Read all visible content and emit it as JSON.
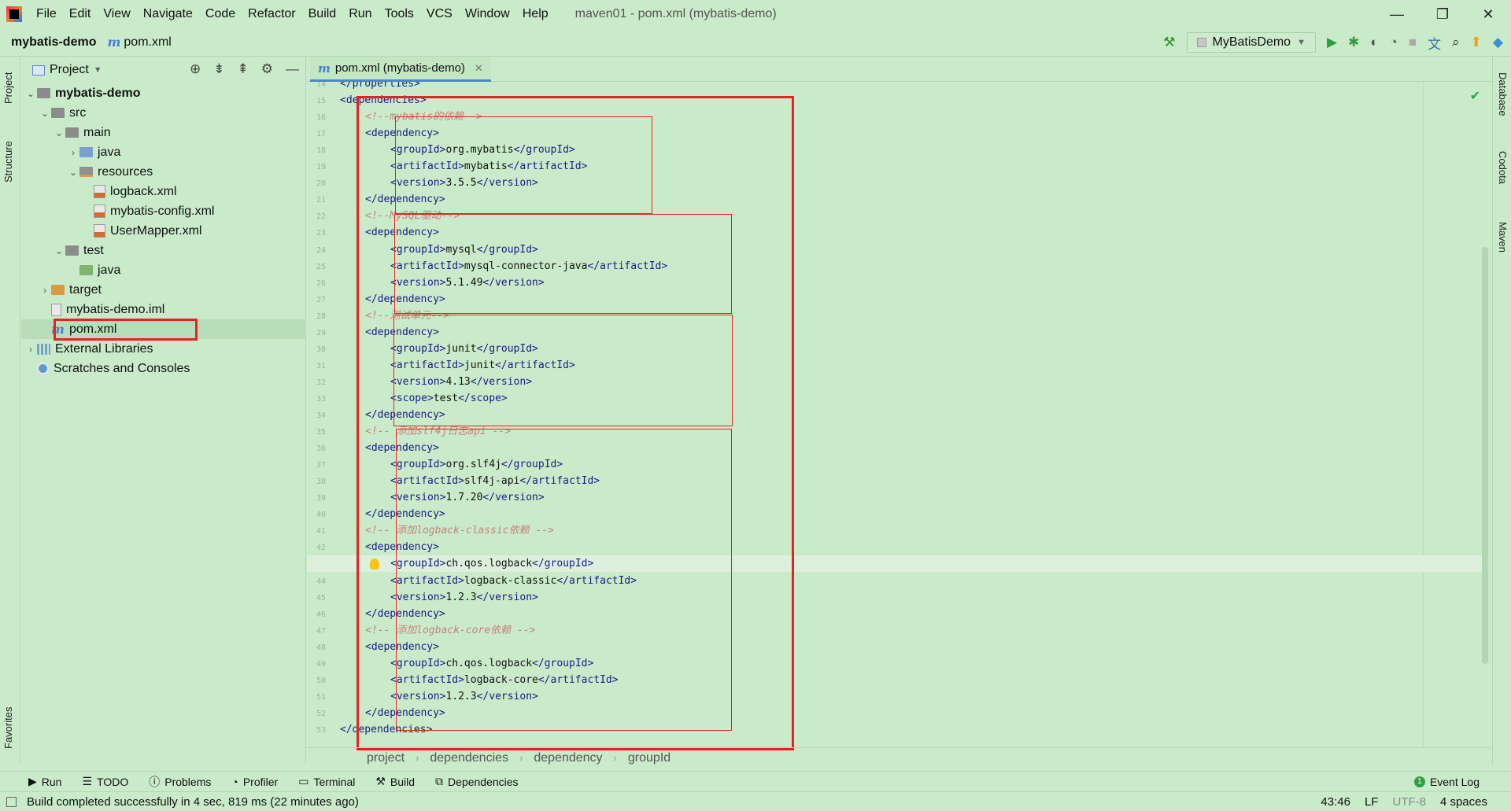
{
  "window": {
    "title": "maven01 - pom.xml (mybatis-demo)",
    "menu": [
      "File",
      "Edit",
      "View",
      "Navigate",
      "Code",
      "Refactor",
      "Build",
      "Run",
      "Tools",
      "VCS",
      "Window",
      "Help"
    ],
    "controls": [
      "—",
      "❐",
      "✕"
    ]
  },
  "navbar": {
    "project": "mybatis-demo",
    "file": "pom.xml",
    "run_config": "MyBatisDemo"
  },
  "left_strip": {
    "project_tab": "Project",
    "structure_tab": "Structure",
    "favorites_tab": "Favorites"
  },
  "right_strip": {
    "database_tab": "Database",
    "codota_tab": "Codota",
    "maven_tab": "Maven"
  },
  "project_panel": {
    "title": "Project",
    "tree": [
      {
        "label": "mybatis-demo",
        "depth": 0,
        "arrow": "⌄",
        "icon": "folder",
        "bold": true
      },
      {
        "label": "src",
        "depth": 1,
        "arrow": "⌄",
        "icon": "folder"
      },
      {
        "label": "main",
        "depth": 2,
        "arrow": "⌄",
        "icon": "folder"
      },
      {
        "label": "java",
        "depth": 3,
        "arrow": "›",
        "icon": "folder-blue"
      },
      {
        "label": "resources",
        "depth": 3,
        "arrow": "⌄",
        "icon": "folder-res"
      },
      {
        "label": "logback.xml",
        "depth": 4,
        "arrow": "",
        "icon": "xml"
      },
      {
        "label": "mybatis-config.xml",
        "depth": 4,
        "arrow": "",
        "icon": "xml"
      },
      {
        "label": "UserMapper.xml",
        "depth": 4,
        "arrow": "",
        "icon": "xml"
      },
      {
        "label": "test",
        "depth": 2,
        "arrow": "⌄",
        "icon": "folder"
      },
      {
        "label": "java",
        "depth": 3,
        "arrow": "",
        "icon": "folder-green"
      },
      {
        "label": "target",
        "depth": 1,
        "arrow": "›",
        "icon": "folder-orange"
      },
      {
        "label": "mybatis-demo.iml",
        "depth": 1,
        "arrow": "",
        "icon": "iml"
      },
      {
        "label": "pom.xml",
        "depth": 1,
        "arrow": "",
        "icon": "maven",
        "selected": true
      },
      {
        "label": "External Libraries",
        "depth": 0,
        "arrow": "›",
        "icon": "lib"
      },
      {
        "label": "Scratches and Consoles",
        "depth": 0,
        "arrow": "",
        "icon": "scratch"
      }
    ]
  },
  "editor": {
    "tab_label": "pom.xml (mybatis-demo)",
    "current_line": 43,
    "lines": [
      {
        "n": "14",
        "indent": 1,
        "parts": [
          [
            "tag",
            "</"
          ],
          [
            "tag",
            "properties"
          ],
          [
            "tag",
            ">"
          ]
        ]
      },
      {
        "n": "15",
        "indent": 1,
        "parts": [
          [
            "tag",
            "<dependencies>"
          ]
        ]
      },
      {
        "n": "16",
        "indent": 2,
        "parts": [
          [
            "cmt",
            "<!--mybatis的依赖-->"
          ]
        ]
      },
      {
        "n": "17",
        "indent": 2,
        "parts": [
          [
            "tag",
            "<dependency>"
          ]
        ]
      },
      {
        "n": "18",
        "indent": 3,
        "parts": [
          [
            "tag",
            "<groupId>"
          ],
          [
            "txt",
            "org.mybatis"
          ],
          [
            "tag",
            "</groupId>"
          ]
        ]
      },
      {
        "n": "19",
        "indent": 3,
        "parts": [
          [
            "tag",
            "<artifactId>"
          ],
          [
            "txt",
            "mybatis"
          ],
          [
            "tag",
            "</artifactId>"
          ]
        ]
      },
      {
        "n": "20",
        "indent": 3,
        "parts": [
          [
            "tag",
            "<version>"
          ],
          [
            "txt",
            "3.5.5"
          ],
          [
            "tag",
            "</version>"
          ]
        ]
      },
      {
        "n": "21",
        "indent": 2,
        "parts": [
          [
            "tag",
            "</dependency>"
          ]
        ]
      },
      {
        "n": "22",
        "indent": 2,
        "parts": [
          [
            "cmt",
            "<!--MySQL驱动-->"
          ]
        ]
      },
      {
        "n": "23",
        "indent": 2,
        "parts": [
          [
            "tag",
            "<dependency>"
          ]
        ]
      },
      {
        "n": "24",
        "indent": 3,
        "parts": [
          [
            "tag",
            "<groupId>"
          ],
          [
            "txt",
            "mysql"
          ],
          [
            "tag",
            "</groupId>"
          ]
        ]
      },
      {
        "n": "25",
        "indent": 3,
        "parts": [
          [
            "tag",
            "<artifactId>"
          ],
          [
            "txt",
            "mysql-connector-java"
          ],
          [
            "tag",
            "</artifactId>"
          ]
        ]
      },
      {
        "n": "26",
        "indent": 3,
        "parts": [
          [
            "tag",
            "<version>"
          ],
          [
            "txt",
            "5.1.49"
          ],
          [
            "tag",
            "</version>"
          ]
        ]
      },
      {
        "n": "27",
        "indent": 2,
        "parts": [
          [
            "tag",
            "</dependency>"
          ]
        ]
      },
      {
        "n": "28",
        "indent": 2,
        "parts": [
          [
            "cmt",
            "<!--测试单元-->"
          ]
        ]
      },
      {
        "n": "29",
        "indent": 2,
        "parts": [
          [
            "tag",
            "<dependency>"
          ]
        ]
      },
      {
        "n": "30",
        "indent": 3,
        "parts": [
          [
            "tag",
            "<groupId>"
          ],
          [
            "txt",
            "junit"
          ],
          [
            "tag",
            "</groupId>"
          ]
        ]
      },
      {
        "n": "31",
        "indent": 3,
        "parts": [
          [
            "tag",
            "<artifactId>"
          ],
          [
            "txt",
            "junit"
          ],
          [
            "tag",
            "</artifactId>"
          ]
        ]
      },
      {
        "n": "32",
        "indent": 3,
        "parts": [
          [
            "tag",
            "<version>"
          ],
          [
            "txt",
            "4.13"
          ],
          [
            "tag",
            "</version>"
          ]
        ]
      },
      {
        "n": "33",
        "indent": 3,
        "parts": [
          [
            "tag",
            "<scope>"
          ],
          [
            "txt",
            "test"
          ],
          [
            "tag",
            "</scope>"
          ]
        ]
      },
      {
        "n": "34",
        "indent": 2,
        "parts": [
          [
            "tag",
            "</dependency>"
          ]
        ]
      },
      {
        "n": "35",
        "indent": 2,
        "parts": [
          [
            "cmt",
            "<!-- 添加slf4j日志api -->"
          ]
        ]
      },
      {
        "n": "36",
        "indent": 2,
        "parts": [
          [
            "tag",
            "<dependency>"
          ]
        ]
      },
      {
        "n": "37",
        "indent": 3,
        "parts": [
          [
            "tag",
            "<groupId>"
          ],
          [
            "txt",
            "org.slf4j"
          ],
          [
            "tag",
            "</groupId>"
          ]
        ]
      },
      {
        "n": "38",
        "indent": 3,
        "parts": [
          [
            "tag",
            "<artifactId>"
          ],
          [
            "txt",
            "slf4j-api"
          ],
          [
            "tag",
            "</artifactId>"
          ]
        ]
      },
      {
        "n": "39",
        "indent": 3,
        "parts": [
          [
            "tag",
            "<version>"
          ],
          [
            "txt",
            "1.7.20"
          ],
          [
            "tag",
            "</version>"
          ]
        ]
      },
      {
        "n": "40",
        "indent": 2,
        "parts": [
          [
            "tag",
            "</dependency>"
          ]
        ]
      },
      {
        "n": "41",
        "indent": 2,
        "parts": [
          [
            "cmt",
            "<!-- 添加logback-classic依赖 -->"
          ]
        ]
      },
      {
        "n": "42",
        "indent": 2,
        "parts": [
          [
            "tag",
            "<dependency>"
          ]
        ]
      },
      {
        "n": "43",
        "indent": 3,
        "parts": [
          [
            "tag",
            "<groupId>"
          ],
          [
            "txt",
            "ch.qos.logback"
          ],
          [
            "tag",
            "</groupId>"
          ]
        ]
      },
      {
        "n": "44",
        "indent": 3,
        "parts": [
          [
            "tag",
            "<artifactId>"
          ],
          [
            "txt",
            "logback-classic"
          ],
          [
            "tag",
            "</artifactId>"
          ]
        ]
      },
      {
        "n": "45",
        "indent": 3,
        "parts": [
          [
            "tag",
            "<version>"
          ],
          [
            "txt",
            "1.2.3"
          ],
          [
            "tag",
            "</version>"
          ]
        ]
      },
      {
        "n": "46",
        "indent": 2,
        "parts": [
          [
            "tag",
            "</dependency>"
          ]
        ]
      },
      {
        "n": "47",
        "indent": 2,
        "parts": [
          [
            "cmt",
            "<!-- 添加logback-core依赖 -->"
          ]
        ]
      },
      {
        "n": "48",
        "indent": 2,
        "parts": [
          [
            "tag",
            "<dependency>"
          ]
        ]
      },
      {
        "n": "49",
        "indent": 3,
        "parts": [
          [
            "tag",
            "<groupId>"
          ],
          [
            "txt",
            "ch.qos.logback"
          ],
          [
            "tag",
            "</groupId>"
          ]
        ]
      },
      {
        "n": "50",
        "indent": 3,
        "parts": [
          [
            "tag",
            "<artifactId>"
          ],
          [
            "txt",
            "logback-core"
          ],
          [
            "tag",
            "</artifactId>"
          ]
        ]
      },
      {
        "n": "51",
        "indent": 3,
        "parts": [
          [
            "tag",
            "<version>"
          ],
          [
            "txt",
            "1.2.3"
          ],
          [
            "tag",
            "</version>"
          ]
        ]
      },
      {
        "n": "52",
        "indent": 2,
        "parts": [
          [
            "tag",
            "</dependency>"
          ]
        ]
      },
      {
        "n": "53",
        "indent": 1,
        "parts": [
          [
            "tag",
            "</dependencies>"
          ]
        ]
      }
    ]
  },
  "breadcrumbs": [
    "project",
    "dependencies",
    "dependency",
    "groupId"
  ],
  "tool_windows": [
    "Run",
    "TODO",
    "Problems",
    "Profiler",
    "Terminal",
    "Build",
    "Dependencies"
  ],
  "event_log": "Event Log",
  "status": {
    "message": "Build completed successfully in 4 sec, 819 ms (22 minutes ago)",
    "position": "43:46",
    "line_sep": "LF",
    "encoding": "UTF-8",
    "indent": "4 spaces"
  },
  "colors": {
    "background": "#c9ebc9",
    "tag": "#1a1a88",
    "comment": "#c77f7f",
    "annotation": "#e22424"
  }
}
